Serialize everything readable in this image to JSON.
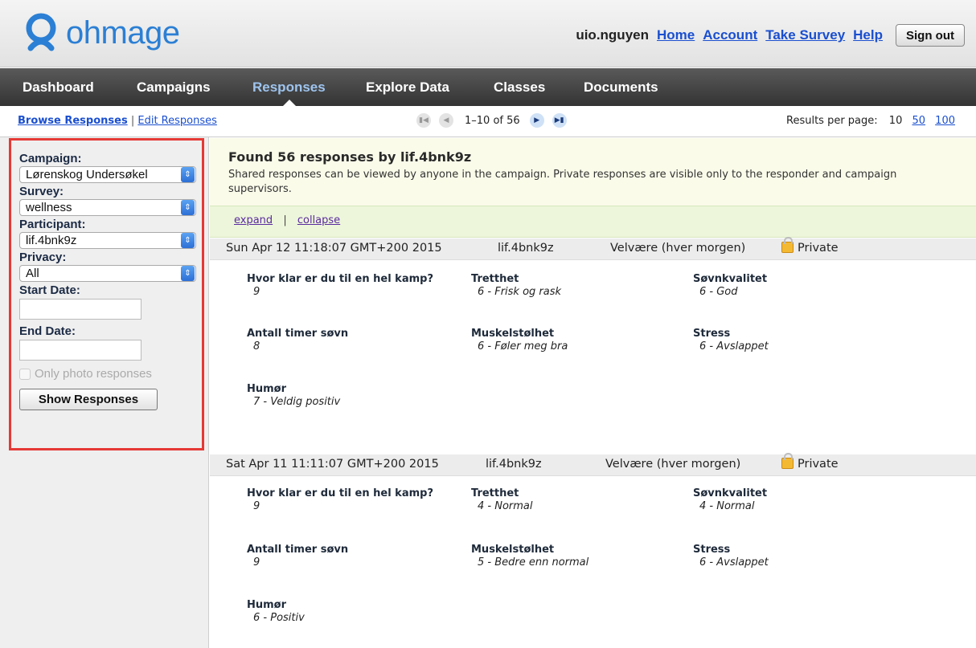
{
  "header": {
    "logo_text": "ohmage",
    "username": "uio.nguyen",
    "links": [
      "Home",
      "Account",
      "Take Survey",
      "Help"
    ],
    "signout_label": "Sign out"
  },
  "nav": {
    "items": [
      "Dashboard",
      "Campaigns",
      "Responses",
      "Explore Data",
      "Classes",
      "Documents"
    ],
    "active": "Responses"
  },
  "subbar": {
    "browse_label": "Browse Responses",
    "separator": "|",
    "edit_label": "Edit Responses",
    "range": "1–10 of 56",
    "per_page_label": "Results per page:",
    "per_page_options": [
      "10",
      "50",
      "100"
    ],
    "per_page_current": "10"
  },
  "filters": {
    "campaign_label": "Campaign:",
    "campaign_value": "Lørenskog Undersøkel",
    "survey_label": "Survey:",
    "survey_value": "wellness",
    "participant_label": "Participant:",
    "participant_value": "lif.4bnk9z",
    "privacy_label": "Privacy:",
    "privacy_value": "All",
    "start_label": "Start Date:",
    "end_label": "End Date:",
    "photo_label": "Only photo responses",
    "show_button": "Show Responses"
  },
  "info": {
    "title": "Found 56 responses by lif.4bnk9z",
    "description": "Shared responses can be viewed by anyone in the campaign. Private responses are visible only to the responder and campaign supervisors.",
    "expand": "expand",
    "sep": "|",
    "collapse": "collapse"
  },
  "responses": [
    {
      "date": "Sun Apr 12 11:18:07 GMT+200 2015",
      "user": "lif.4bnk9z",
      "survey": "Velvære (hver morgen)",
      "privacy": "Private",
      "fields": [
        {
          "q": "Hvor klar er du til en hel kamp?",
          "a": "9"
        },
        {
          "q": "Tretthet",
          "a": "6 - Frisk og rask"
        },
        {
          "q": "Søvnkvalitet",
          "a": "6 - God"
        },
        {
          "q": "Antall timer søvn",
          "a": "8"
        },
        {
          "q": "Muskelstølhet",
          "a": "6 - Føler meg bra"
        },
        {
          "q": "Stress",
          "a": "6 - Avslappet"
        },
        {
          "q": "Humør",
          "a": "7 - Veldig positiv"
        }
      ]
    },
    {
      "date": "Sat Apr 11 11:11:07 GMT+200 2015",
      "user": "lif.4bnk9z",
      "survey": "Velvære (hver morgen)",
      "privacy": "Private",
      "fields": [
        {
          "q": "Hvor klar er du til en hel kamp?",
          "a": "9"
        },
        {
          "q": "Tretthet",
          "a": "4 - Normal"
        },
        {
          "q": "Søvnkvalitet",
          "a": "4 - Normal"
        },
        {
          "q": "Antall timer søvn",
          "a": "9"
        },
        {
          "q": "Muskelstølhet",
          "a": "5 - Bedre enn normal"
        },
        {
          "q": "Stress",
          "a": "6 - Avslappet"
        },
        {
          "q": "Humør",
          "a": "6 - Positiv"
        }
      ]
    }
  ]
}
